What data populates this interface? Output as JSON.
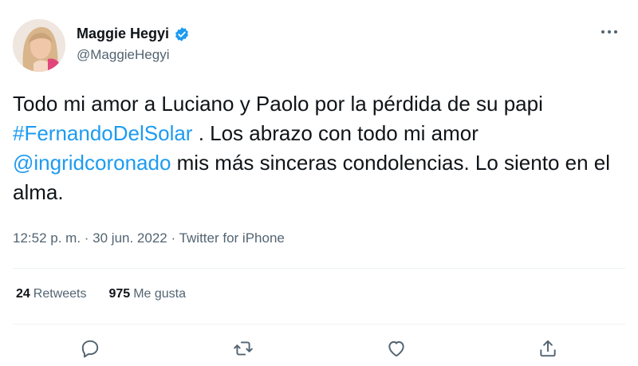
{
  "author": {
    "name": "Maggie Hegyi",
    "handle": "@MaggieHegyi",
    "verified": true
  },
  "tweet": {
    "part1": "Todo mi amor a Luciano y Paolo por la pérdida de su papi ",
    "hashtag": "#FernandoDelSolar",
    "part2": " . Los abrazo con todo mi amor ",
    "mention": "@ingridcoronado",
    "part3": " mis más sinceras condolencias. Lo siento en el alma."
  },
  "meta": {
    "time": "12:52 p. m.",
    "separator": " · ",
    "date": "30 jun. 2022",
    "source": "Twitter for iPhone"
  },
  "stats": {
    "retweets_count": "24",
    "retweets_label": "Retweets",
    "likes_count": "975",
    "likes_label": "Me gusta"
  },
  "icons": {
    "more": "more-icon",
    "reply": "reply-icon",
    "retweet": "retweet-icon",
    "like": "like-icon",
    "share": "share-icon",
    "verified": "verified-badge-icon"
  },
  "colors": {
    "accent": "#1d9bf0",
    "text": "#0f1419",
    "muted": "#536471"
  }
}
